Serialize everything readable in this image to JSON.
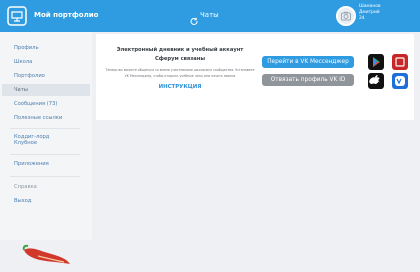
{
  "header": {
    "brand": "Мой портфолио",
    "crumb": "Чаты",
    "user_lines": [
      "Шаманов",
      "Дмитрий",
      "24"
    ]
  },
  "sidebar": {
    "items": [
      {
        "label": "Профиль"
      },
      {
        "label": "Школа"
      },
      {
        "label": "Портфолио"
      },
      {
        "label": "Чаты"
      },
      {
        "label": "Сообщения (73)"
      },
      {
        "label": "Полезные ссылки"
      },
      {
        "label": "Коддиг-лорд Клубное"
      },
      {
        "label": "Приложения"
      },
      {
        "label": "Справка"
      },
      {
        "label": "Выход"
      }
    ]
  },
  "main": {
    "title": "Электронный дневник и учебный аккаунт Сферум связаны",
    "description": "Теперь вы можете общаться со всеми участниками школьного сообщества. Установите VK Мессенджер, чтобы открыть учебные чаты или начать звонки",
    "instruction": "ИНСТРУКЦИЯ",
    "primary_button": "Перейти в VK Мессенджер",
    "secondary_button": "Отвязать профиль VK ID"
  },
  "icons": {
    "logo": "portfolio-logo-icon",
    "crumb": "chat-refresh-icon",
    "avatar": "camera-icon",
    "stores": [
      "google-play-icon",
      "rustore-icon",
      "apple-icon",
      "vk-messenger-icon"
    ]
  },
  "colors": {
    "accent": "#2f9be0",
    "gray_button": "#8f959b"
  }
}
